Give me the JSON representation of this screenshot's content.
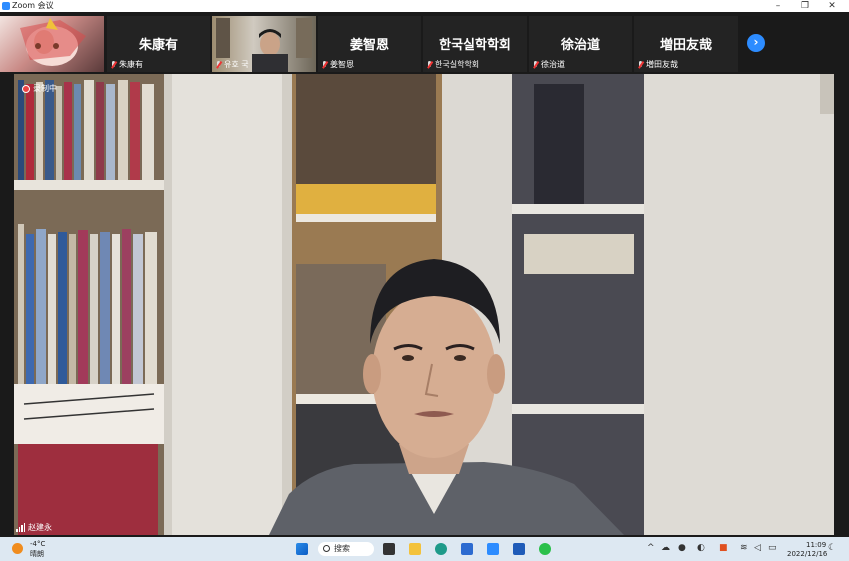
{
  "window": {
    "title": "Zoom 会议",
    "minimize": "–",
    "restore": "❐",
    "close": "✕"
  },
  "participants": [
    {
      "display": "",
      "label": ""
    },
    {
      "display": "朱康有",
      "label": "朱康有"
    },
    {
      "display": "",
      "label": "유호 국"
    },
    {
      "display": "姜智恩",
      "label": "姜智恩"
    },
    {
      "display": "한국실학학회",
      "label": "한국실학학회"
    },
    {
      "display": "徐治道",
      "label": "徐治道"
    },
    {
      "display": "増田友哉",
      "label": "増田友哉"
    }
  ],
  "next_arrow": "›",
  "main": {
    "recording": "录制中",
    "speaker": "赵建永"
  },
  "taskbar": {
    "weather_temp": "-4°C",
    "weather_desc": "晴朗",
    "search": "搜索",
    "time": "11:09",
    "date": "2022/12/16"
  },
  "icons": [
    "zoom-icon",
    "windows-start-icon",
    "task-view-icon",
    "file-explorer-icon",
    "edge-icon",
    "store-icon",
    "zoom-taskbar-icon",
    "word-icon",
    "wechat-icon",
    "chevron-up-icon",
    "onedrive-icon",
    "mic-icon",
    "speaker-icon",
    "wifi-icon",
    "volume-icon",
    "battery-icon",
    "notification-icon"
  ]
}
